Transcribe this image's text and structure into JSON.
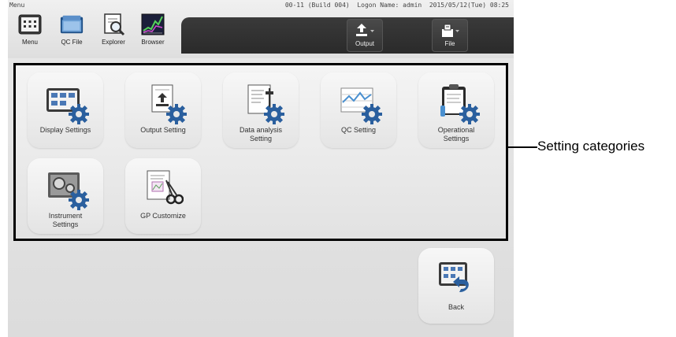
{
  "header": {
    "caption": "Menu",
    "status": "00-11 (Build 004)  Logon Name: admin  2015/05/12(Tue) 08:25"
  },
  "toolbar": {
    "items": [
      {
        "label": "Menu",
        "icon": "menu-grid-icon"
      },
      {
        "label": "QC File",
        "icon": "qc-file-icon"
      },
      {
        "label": "Explorer",
        "icon": "explorer-icon"
      },
      {
        "label": "Browser",
        "icon": "browser-icon"
      }
    ],
    "output_label": "Output",
    "file_label": "File"
  },
  "settings": {
    "tiles": [
      {
        "label": "Display Settings",
        "icon": "display-settings-icon"
      },
      {
        "label": "Output Setting",
        "icon": "output-setting-icon"
      },
      {
        "label": "Data analysis\nSetting",
        "icon": "data-analysis-icon"
      },
      {
        "label": "QC Setting",
        "icon": "qc-setting-icon"
      },
      {
        "label": "Operational\nSettings",
        "icon": "operational-settings-icon"
      },
      {
        "label": "Instrument\nSettings",
        "icon": "instrument-settings-icon"
      },
      {
        "label": "GP Customize",
        "icon": "gp-customize-icon"
      }
    ]
  },
  "back_label": "Back",
  "annotation": "Setting categories",
  "colors": {
    "accent": "#2a5f9e",
    "panel_border": "#000000",
    "darkbar": "#2f2f2f"
  }
}
